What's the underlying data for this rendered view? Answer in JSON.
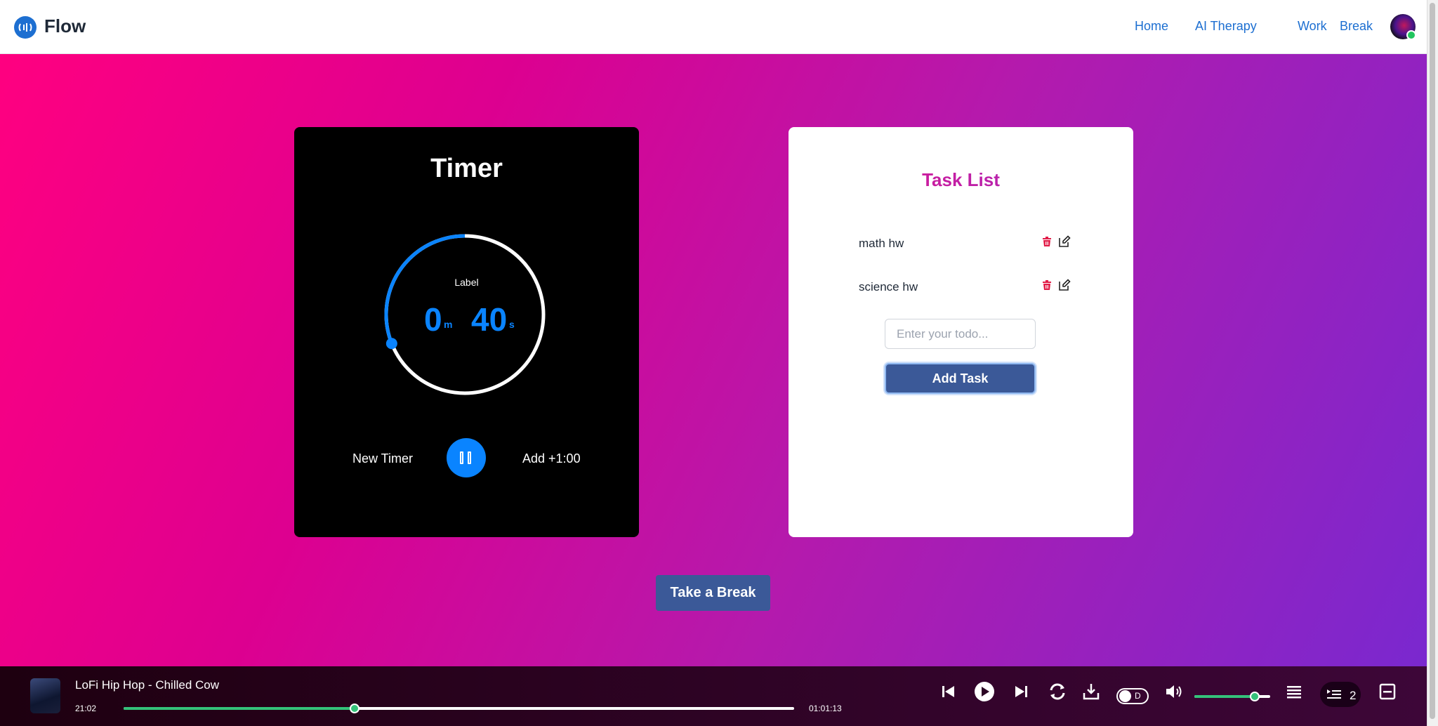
{
  "header": {
    "brand": "Flow",
    "nav": [
      "Home",
      "AI Therapy",
      "Work",
      "Break"
    ]
  },
  "timer": {
    "title": "Timer",
    "label": "Label",
    "minutes": "0",
    "minutes_unit": "m",
    "seconds": "40",
    "seconds_unit": "s",
    "remaining_fraction": 0.69,
    "new_timer": "New Timer",
    "add_time": "Add +1:00"
  },
  "tasks": {
    "title": "Task List",
    "items": [
      "math hw",
      "science hw"
    ],
    "input_placeholder": "Enter your todo...",
    "add_button": "Add Task"
  },
  "break_button": "Take a Break",
  "player": {
    "track": "LoFi Hip Hop - Chilled Cow",
    "elapsed": "21:02",
    "duration": "01:01:13",
    "progress_fraction": 0.344,
    "volume_fraction": 0.8,
    "toggle_label": "D",
    "queue_count": "2"
  },
  "colors": {
    "accent_blue": "#0a84ff",
    "nav_blue": "#1d6fd1",
    "button_blue": "#3b5998",
    "player_green": "#34c27a",
    "delete_red": "#e11d48"
  }
}
